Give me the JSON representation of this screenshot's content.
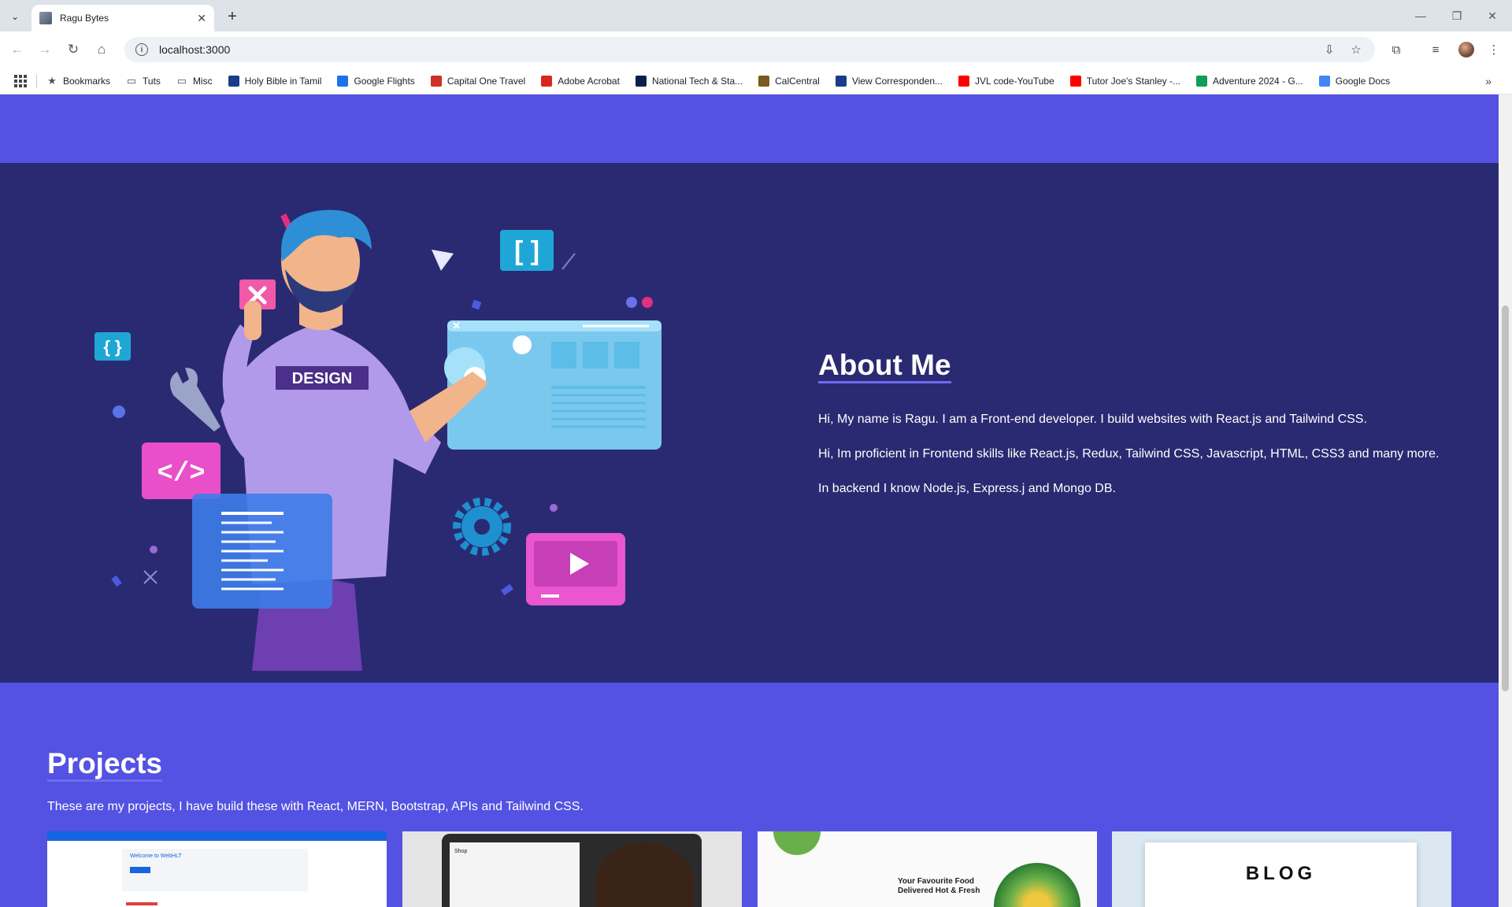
{
  "browser": {
    "tab_title": "Ragu Bytes",
    "url": "localhost:3000",
    "bookmarks": [
      {
        "label": "Bookmarks",
        "icon": "star-icon",
        "color": "#555555"
      },
      {
        "label": "Tuts",
        "icon": "folder-icon",
        "color": "#555555"
      },
      {
        "label": "Misc",
        "icon": "folder-icon",
        "color": "#555555"
      },
      {
        "label": "Holy Bible in Tamil",
        "icon": "bible-icon",
        "color": "#1a3c8c"
      },
      {
        "label": "Google Flights",
        "icon": "flights-icon",
        "color": "#1a73e8"
      },
      {
        "label": "Capital One Travel",
        "icon": "capitalone-icon",
        "color": "#d03027"
      },
      {
        "label": "Adobe Acrobat",
        "icon": "acrobat-icon",
        "color": "#d7281e"
      },
      {
        "label": "National Tech & Sta...",
        "icon": "nts-icon",
        "color": "#0b1f4b"
      },
      {
        "label": "CalCentral",
        "icon": "calcentral-icon",
        "color": "#7a5a20"
      },
      {
        "label": "View Corresponden...",
        "icon": "colorado-icon",
        "color": "#1a3c8c"
      },
      {
        "label": "JVL code-YouTube",
        "icon": "youtube-icon",
        "color": "#ff0000"
      },
      {
        "label": "Tutor Joe's Stanley -...",
        "icon": "youtube-icon",
        "color": "#ff0000"
      },
      {
        "label": "Adventure 2024 - G...",
        "icon": "sheets-icon",
        "color": "#0f9d58"
      },
      {
        "label": "Google Docs",
        "icon": "docs-icon",
        "color": "#4285f4"
      }
    ]
  },
  "about": {
    "title": "About Me",
    "paragraphs": [
      "Hi, My name is Ragu. I am a Front-end developer. I build websites with React.js and Tailwind CSS.",
      "Hi, Im proficient in Frontend skills like React.js, Redux, Tailwind CSS, Javascript, HTML, CSS3 and many more.",
      "In backend I know Node.js, Express.j and Mongo DB."
    ],
    "illustration_text": "DESIGN"
  },
  "projects": {
    "title": "Projects",
    "subtitle": "These are my projects, I have build these with React, MERN, Bootstrap, APIs and Tailwind CSS.",
    "cards": [
      {
        "name": "project-card-1",
        "heading": "Welcome to WebHLT"
      },
      {
        "name": "project-card-2",
        "heading": "Shop"
      },
      {
        "name": "project-card-3",
        "heading": "Your Favourite Food Delivered Hot & Fresh"
      },
      {
        "name": "project-card-4",
        "heading": "BLOG"
      }
    ]
  },
  "colors": {
    "page_bg": "#5452e3",
    "about_bg": "#2a2a72",
    "accent_underline": "#6d6bf0"
  }
}
